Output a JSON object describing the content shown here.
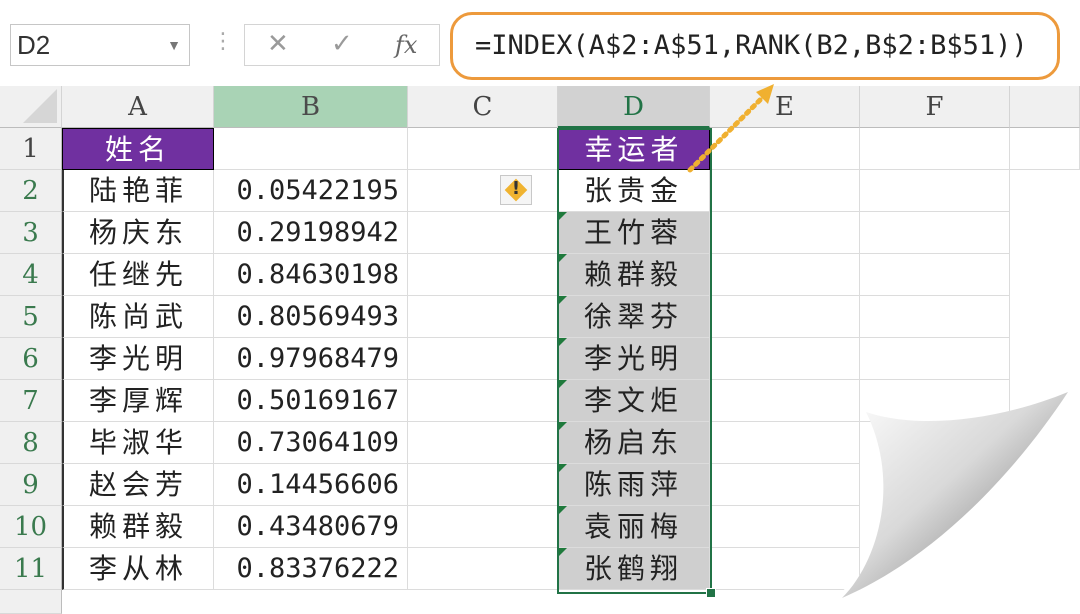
{
  "name_box": "D2",
  "formula": "=INDEX(A$2:A$51,RANK(B2,B$2:B$51))",
  "columns": [
    "A",
    "B",
    "C",
    "D",
    "E",
    "F"
  ],
  "rows": [
    "1",
    "2",
    "3",
    "4",
    "5",
    "6",
    "7",
    "8",
    "9",
    "10",
    "11"
  ],
  "header": {
    "a1": "姓名",
    "d1": "幸运者"
  },
  "names": [
    "陆艳菲",
    "杨庆东",
    "任继先",
    "陈尚武",
    "李光明",
    "李厚辉",
    "毕淑华",
    "赵会芳",
    "赖群毅",
    "李从林"
  ],
  "randoms": [
    "0.05422195",
    "0.29198942",
    "0.84630198",
    "0.80569493",
    "0.97968479",
    "0.50169167",
    "0.73064109",
    "0.14456606",
    "0.43480679",
    "0.83376222"
  ],
  "lucky": [
    "张贵金",
    "王竹蓉",
    "赖群毅",
    "徐翠芬",
    "李光明",
    "李文炬",
    "杨启东",
    "陈雨萍",
    "袁丽梅",
    "张鹤翔"
  ],
  "colors": {
    "accent": "#ED9A3C",
    "header_fill": "#7030a0",
    "selection": "#217346",
    "selected_cells": "#cfcfcf"
  }
}
